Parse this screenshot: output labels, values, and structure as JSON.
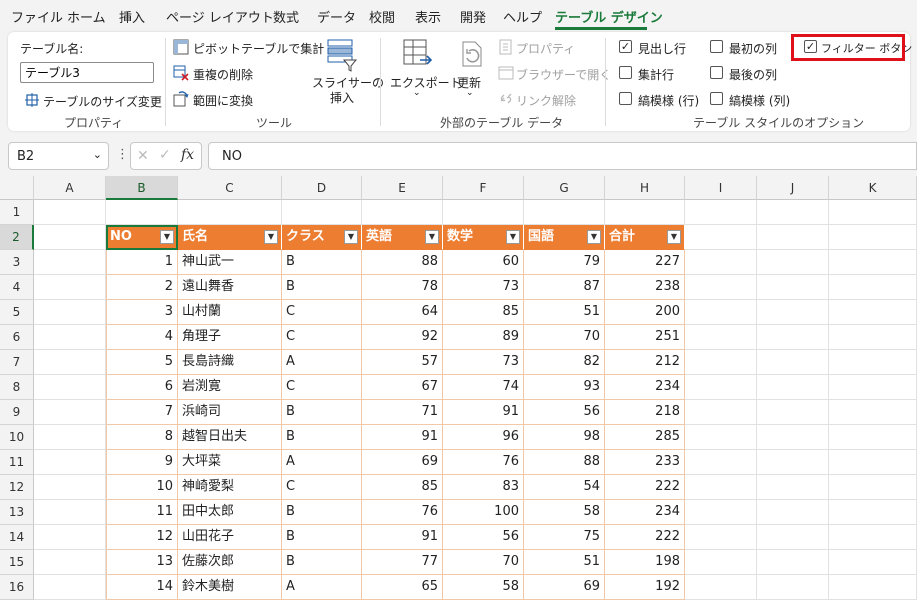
{
  "menu": {
    "items": [
      "ファイル",
      "ホーム",
      "挿入",
      "ページ レイアウト",
      "数式",
      "データ",
      "校閲",
      "表示",
      "開発",
      "ヘルプ",
      "テーブル デザイン"
    ],
    "active_index": 10
  },
  "ribbon": {
    "properties": {
      "name_label": "テーブル名:",
      "name_value": "テーブル3",
      "resize_label": "テーブルのサイズ変更",
      "group_label": "プロパティ"
    },
    "tools": {
      "pivot_label": "ピボットテーブルで集計",
      "remove_dup_label": "重複の削除",
      "convert_label": "範囲に変換",
      "slicer_line1": "スライサーの",
      "slicer_line2": "挿入",
      "group_label": "ツール"
    },
    "external": {
      "export_label": "エクスポート",
      "refresh_label": "更新",
      "properties_label": "プロパティ",
      "browser_label": "ブラウザーで開く",
      "unlink_label": "リンク解除",
      "group_label": "外部のテーブル データ"
    },
    "style_options": {
      "header_row": {
        "label": "見出し行",
        "checked": true
      },
      "total_row": {
        "label": "集計行",
        "checked": false
      },
      "banded_rows": {
        "label": "縞模様 (行)",
        "checked": false
      },
      "first_column": {
        "label": "最初の列",
        "checked": false
      },
      "last_column": {
        "label": "最後の列",
        "checked": false
      },
      "banded_columns": {
        "label": "縞模様 (列)",
        "checked": false
      },
      "filter_button": {
        "label": "フィルター ボタン",
        "checked": true
      },
      "group_label": "テーブル スタイルのオプション"
    }
  },
  "formula_bar": {
    "name_box": "B2",
    "formula": "NO",
    "cancel_glyph": "✕",
    "enter_glyph": "✓",
    "fx_label": "fx"
  },
  "sheet": {
    "columns": [
      "A",
      "B",
      "C",
      "D",
      "E",
      "F",
      "G",
      "H",
      "I",
      "J",
      "K"
    ],
    "selected_column": "B",
    "selected_row": 2,
    "row_numbers": [
      1,
      2,
      3,
      4,
      5,
      6,
      7,
      8,
      9,
      10,
      11,
      12,
      13,
      14,
      15,
      16
    ],
    "table": {
      "headers": [
        "NO",
        "氏名",
        "クラス",
        "英語",
        "数学",
        "国語",
        "合計"
      ],
      "rows": [
        [
          1,
          "神山武一",
          "B",
          88,
          60,
          79,
          227
        ],
        [
          2,
          "遠山舞香",
          "B",
          78,
          73,
          87,
          238
        ],
        [
          3,
          "山村蘭",
          "C",
          64,
          85,
          51,
          200
        ],
        [
          4,
          "角理子",
          "C",
          92,
          89,
          70,
          251
        ],
        [
          5,
          "長島詩織",
          "A",
          57,
          73,
          82,
          212
        ],
        [
          6,
          "岩渕寛",
          "C",
          67,
          74,
          93,
          234
        ],
        [
          7,
          "浜崎司",
          "B",
          71,
          91,
          56,
          218
        ],
        [
          8,
          "越智日出夫",
          "B",
          91,
          96,
          98,
          285
        ],
        [
          9,
          "大坪菜",
          "A",
          69,
          76,
          88,
          233
        ],
        [
          10,
          "神崎愛梨",
          "C",
          85,
          83,
          54,
          222
        ],
        [
          11,
          "田中太郎",
          "B",
          76,
          100,
          58,
          234
        ],
        [
          12,
          "山田花子",
          "B",
          91,
          56,
          75,
          222
        ],
        [
          13,
          "佐藤次郎",
          "B",
          77,
          70,
          51,
          198
        ],
        [
          14,
          "鈴木美樹",
          "A",
          65,
          58,
          69,
          192
        ]
      ]
    }
  },
  "colors": {
    "table_header": "#ed7d31",
    "accent": "#1a7a3a",
    "highlight_box": "#e0101a"
  }
}
